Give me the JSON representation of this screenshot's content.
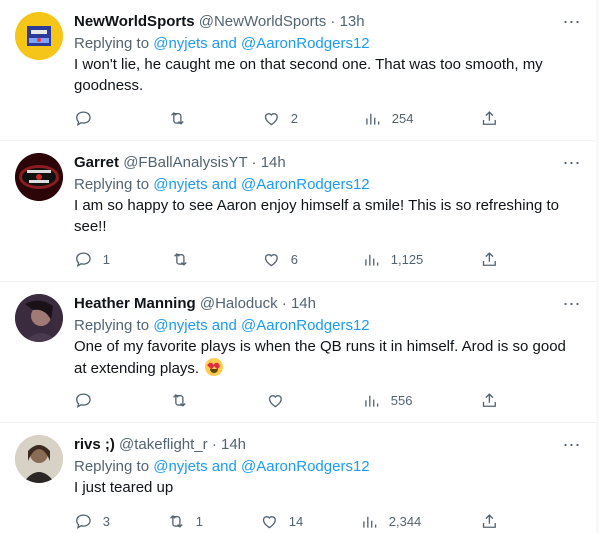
{
  "tweets": [
    {
      "name": "NewWorldSports",
      "handle": "@NewWorldSports",
      "sep": "·",
      "time": "13h",
      "replying_prefix": "Replying to",
      "replying_targets": "@nyjets and @AaronRodgers12",
      "text": "I won't lie, he caught me on that second one. That was too smooth, my goodness.",
      "replies": "",
      "retweets": "",
      "likes": "2",
      "views": "254",
      "avatar_icon": "newworldsports-logo"
    },
    {
      "name": "Garret",
      "handle": "@FBallAnalysisYT",
      "sep": "·",
      "time": "14h",
      "replying_prefix": "Replying to",
      "replying_targets": "@nyjets and @AaronRodgers12",
      "text": "I am so happy to see Aaron enjoy himself a smile! This is so refreshing to see!!",
      "replies": "1",
      "retweets": "",
      "likes": "6",
      "views": "1,125",
      "avatar_icon": "football-analysis-logo"
    },
    {
      "name": "Heather Manning",
      "handle": "@Haloduck",
      "sep": "·",
      "time": "14h",
      "replying_prefix": "Replying to",
      "replying_targets": "@nyjets and @AaronRodgers12",
      "text": "One of my favorite plays is when the QB runs it in himself. Arod is so good at extending plays.",
      "replies": "",
      "retweets": "",
      "likes": "",
      "views": "556",
      "avatar_icon": "profile-photo"
    },
    {
      "name": "rivs ;)",
      "handle": "@takeflight_r",
      "sep": "·",
      "time": "14h",
      "replying_prefix": "Replying to",
      "replying_targets": "@nyjets and @AaronRodgers12",
      "text": "I just teared up",
      "replies": "3",
      "retweets": "1",
      "likes": "14",
      "views": "2,344",
      "avatar_icon": "profile-photo"
    }
  ],
  "more_icon": "⋯",
  "colors": {
    "link": "#1d9bf0",
    "muted": "#536471",
    "text": "#0f1419",
    "divider": "#eff3f4"
  }
}
